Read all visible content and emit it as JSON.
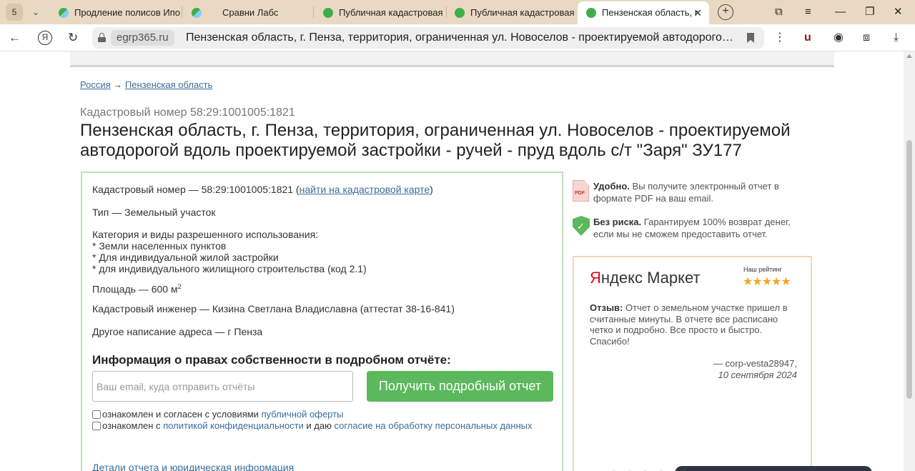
{
  "browser": {
    "tab_count": "5",
    "tabs": [
      {
        "label": "Продление полисов Ипо",
        "icon": "sravni-icon",
        "color": "#3fae49"
      },
      {
        "label": "Сравни Лабс",
        "icon": "sravni-icon",
        "color": "#3fae49"
      },
      {
        "label": "Публичная кадастровая",
        "icon": "check-circle-icon",
        "color": "#3fae49"
      },
      {
        "label": "Публичная кадастровая",
        "icon": "check-circle-icon",
        "color": "#3fae49"
      },
      {
        "label": "Пензенская область, г",
        "icon": "check-circle-icon",
        "color": "#3fae49"
      }
    ],
    "domain": "egrp365.ru",
    "url_title": "Пензенская область, г. Пенза, территория, ограниченная ул. Новоселов - проектируемой автодорогой..."
  },
  "breadcrumb": {
    "items": [
      "Россия",
      "Пензенская область"
    ],
    "separator": "→"
  },
  "cadastral_subtitle": "Кадастровый номер 58:29:1001005:1821",
  "title": "Пензенская область, г. Пенза, территория, ограниченная ул. Новоселов - проектируемой автодорогой вдоль проектируемой застройки - ручей - пруд вдоль с/т \"Заря\" ЗУ177",
  "info": {
    "cad_prefix": "Кадастровый номер — 58:29:1001005:1821 (",
    "cad_link": "найти на кадастровой карте",
    "cad_suffix": ")",
    "type": "Тип — Земельный участок",
    "category_header": "Категория и виды разрешенного использования:",
    "categories": [
      "* Земли населенных пунктов",
      "* Для индивидуальной жилой застройки",
      "* для индивидуального жилищного строительства (код 2.1)"
    ],
    "area_prefix": "Площадь — 600 м",
    "area_sup": "2",
    "engineer": "Кадастровый инженер — Кизина Светлана Владиславна (аттестат 38-16-841)",
    "alt_address": "Другое написание адреса — г Пенза"
  },
  "rights": {
    "heading": "Информация о правах собственности в подробном отчёте:",
    "email_placeholder": "Ваш email, куда отправить отчёты",
    "button": "Получить подробный отчет",
    "consent1_text": "ознакомлен и согласен с условиями ",
    "consent1_link": "публичной оферты",
    "consent2_text1": "ознакомлен с ",
    "consent2_link1": "политикой конфиденциальности",
    "consent2_text2": " и даю ",
    "consent2_link2": "согласие на обработку персональных данных",
    "details_link": "Детали отчета и юридическая информация"
  },
  "benefits": [
    {
      "icon": "pdf-icon",
      "bold": "Удобно.",
      "text": " Вы получите электронный отчет в формате PDF на ваш email.",
      "icon_label": "PDF"
    },
    {
      "icon": "shield-check-icon",
      "bold": "Без риска.",
      "text": " Гарантируем 100% возврат денег, если мы не сможем предоставить отчет.",
      "icon_label": "✓"
    }
  ],
  "review": {
    "logo_red": "Я",
    "logo_rest": "ндекс Маркет",
    "rating_label": "Наш рейтинг",
    "stars": "★★★★★",
    "label": "Отзыв:",
    "text": " Отчет о земельном участке пришел в считанные минуты. В отчете все расписано четко и подробно. Все просто и быстро. Спасибо!",
    "author": "— corp-vesta28947,",
    "date": "10 сентября 2024"
  },
  "colors": {
    "accent_green": "#5cb85c",
    "link_blue": "#3a6d9a",
    "tabbar_bg": "#e9d9c3"
  }
}
